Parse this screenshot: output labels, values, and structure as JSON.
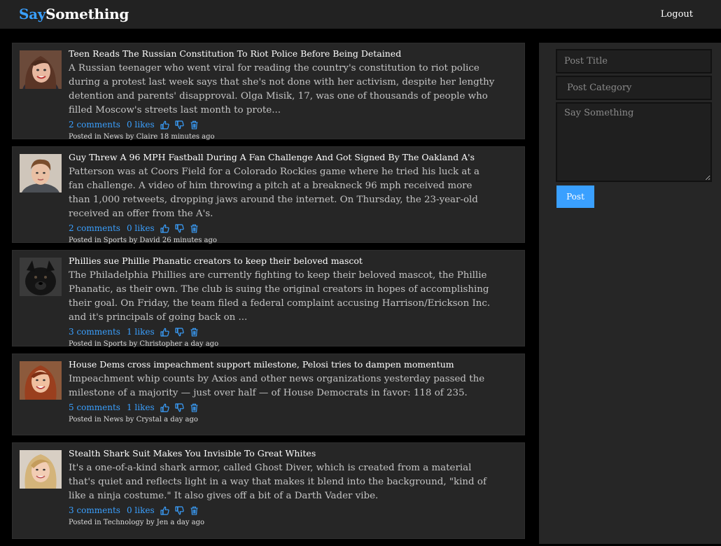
{
  "app": {
    "brand_say": "Say",
    "brand_something": "Something",
    "logout_label": "Logout"
  },
  "composer": {
    "title_placeholder": "Post Title",
    "category_placeholder": "Post Category",
    "body_placeholder": "Say Something",
    "post_label": "Post"
  },
  "colors": {
    "accent": "#3aa0ff",
    "panel": "#262626",
    "background": "#000000",
    "topbar": "#222222"
  },
  "posts": [
    {
      "title": "Teen Reads The Russian Constitution To Riot Police Before Being Detained",
      "body": "A Russian teenager who went viral for reading the country's constitution to riot police during a protest last week says that she's not done with her activism, despite her lengthy detention and parents' disapproval. Olga Misik, 17, was one of thousands of people who filled Moscow's streets last month to prote...",
      "comments": "2 comments",
      "likes": "0 likes",
      "meta": "Posted in News by Claire 18 minutes ago",
      "avatar": "woman-brown-hair"
    },
    {
      "title": "Guy Threw A 96 MPH Fastball During A Fan Challenge And Got Signed By The Oakland A's",
      "body": "Patterson was at Coors Field for a Colorado Rockies game where he tried his luck at a fan challenge. A video of him throwing a pitch at a breakneck 96 mph received more than 1,000 retweets, dropping jaws around the internet. On Thursday, the 23-year-old received an offer from the A's.",
      "comments": "2 comments",
      "likes": "0 likes",
      "meta": "Posted in Sports by David 26 minutes ago",
      "avatar": "man-short-hair"
    },
    {
      "title": "Phillies sue Phillie Phanatic creators to keep their beloved mascot",
      "body": "The Philadelphia Phillies are currently fighting to keep their beloved mascot, the Phillie Phanatic, as their own. The club is suing the original creators in hopes of accomplishing their goal. On Friday, the team filed a federal complaint accusing Harrison/Erickson Inc. and it's principals of going back on ...",
      "comments": "3 comments",
      "likes": "1 likes",
      "meta": "Posted in Sports by Christopher a day ago",
      "avatar": "black-dog"
    },
    {
      "title": "House Dems cross impeachment support milestone, Pelosi tries to dampen momentum",
      "body": "Impeachment whip counts by Axios and other news organizations yesterday passed the milestone of a majority — just over half — of House Democrats in favor: 118 of 235.",
      "comments": "5 comments",
      "likes": "1 likes",
      "meta": "Posted in News by Crystal a day ago",
      "avatar": "woman-red-hair"
    },
    {
      "title": "Stealth Shark Suit Makes You Invisible To Great Whites",
      "body": "It's a one-of-a-kind shark armor, called Ghost Diver, which is created from a material that's quiet and reflects light in a way that makes it blend into the background, \"kind of like a ninja costume.\" It also gives off a bit of a Darth Vader vibe.",
      "comments": "3 comments",
      "likes": "0 likes",
      "meta": "Posted in Technology by Jen a day ago",
      "avatar": "woman-blonde-hair"
    }
  ]
}
